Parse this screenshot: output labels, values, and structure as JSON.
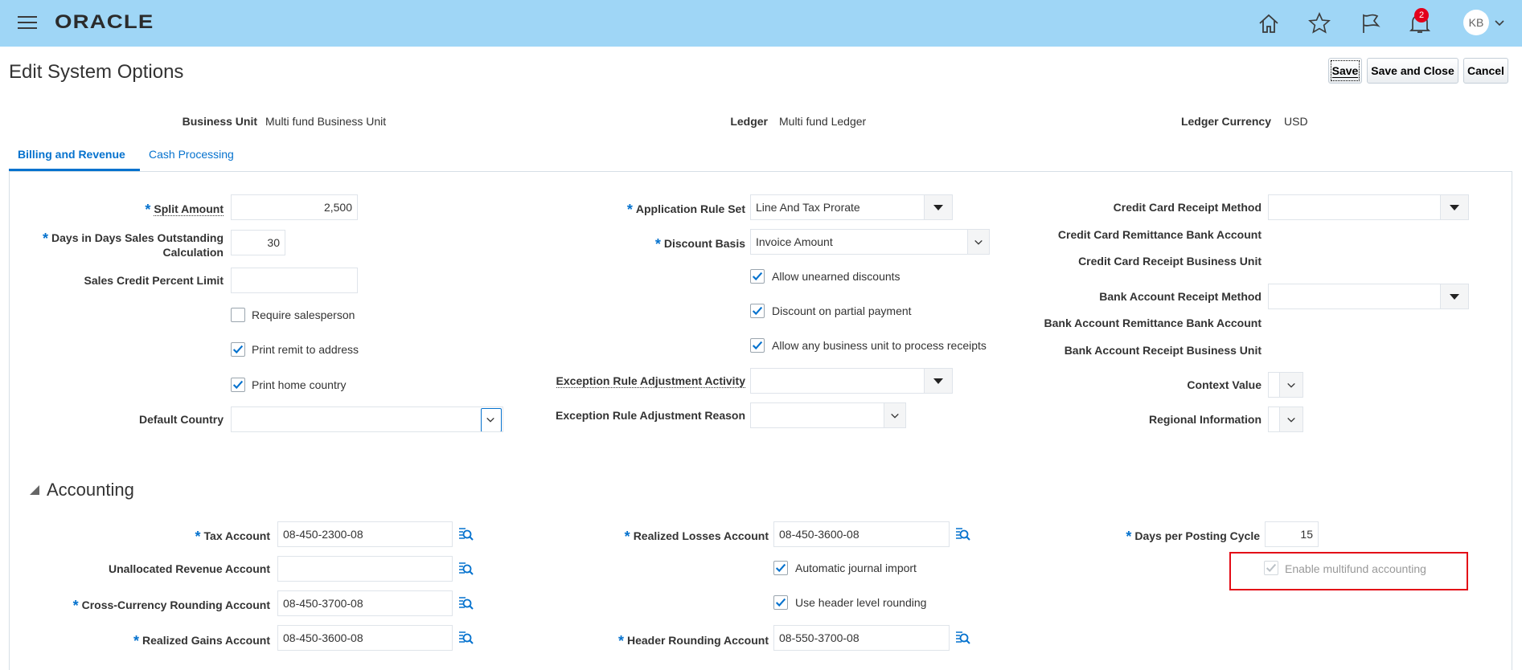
{
  "header": {
    "logo": "ORACLE",
    "notification_count": "2",
    "avatar_initials": "KB"
  },
  "page": {
    "title": "Edit System Options",
    "buttons": {
      "save": "Save",
      "save_close": "Save and Close",
      "cancel": "Cancel"
    }
  },
  "info": {
    "business_unit_label": "Business Unit",
    "business_unit_value": "Multi fund Business Unit",
    "ledger_label": "Ledger",
    "ledger_value": "Multi fund Ledger",
    "ledger_currency_label": "Ledger Currency",
    "ledger_currency_value": "USD"
  },
  "tabs": [
    "Billing and Revenue",
    "Cash Processing"
  ],
  "billing": {
    "split_amount_label": "Split Amount",
    "split_amount_value": "2,500",
    "dso_label_line1": "Days in Days Sales Outstanding",
    "dso_label_line2": "Calculation",
    "dso_value": "30",
    "sales_credit_label": "Sales Credit Percent Limit",
    "sales_credit_value": "",
    "require_salesperson": "Require salesperson",
    "print_remit": "Print remit to address",
    "print_home_country": "Print home country",
    "default_country_label": "Default Country",
    "default_country_value": "",
    "application_rule_set_label": "Application Rule Set",
    "application_rule_set_value": "Line And Tax Prorate",
    "discount_basis_label": "Discount Basis",
    "discount_basis_value": "Invoice Amount",
    "allow_unearned": "Allow unearned discounts",
    "discount_partial": "Discount on partial payment",
    "allow_any_bu": "Allow any business unit to process receipts",
    "exception_activity_label": "Exception Rule Adjustment Activity",
    "exception_activity_value": "",
    "exception_reason_label": "Exception Rule Adjustment Reason",
    "exception_reason_value": "",
    "cc_receipt_method_label": "Credit Card Receipt Method",
    "cc_remittance_bank_label": "Credit Card Remittance Bank Account",
    "cc_receipt_bu_label": "Credit Card Receipt Business Unit",
    "ba_receipt_method_label": "Bank Account Receipt Method",
    "ba_remittance_bank_label": "Bank Account Remittance Bank Account",
    "ba_receipt_bu_label": "Bank Account Receipt Business Unit",
    "context_value_label": "Context Value",
    "regional_info_label": "Regional Information"
  },
  "accounting": {
    "title": "Accounting",
    "tax_account_label": "Tax Account",
    "tax_account_value": "08-450-2300-08",
    "unallocated_label": "Unallocated Revenue Account",
    "unallocated_value": "",
    "cross_currency_label": "Cross-Currency Rounding Account",
    "cross_currency_value": "08-450-3700-08",
    "realized_gains_label": "Realized Gains Account",
    "realized_gains_value": "08-450-3600-08",
    "realized_losses_label": "Realized Losses Account",
    "realized_losses_value": "08-450-3600-08",
    "auto_journal_import": "Automatic journal import",
    "use_header_rounding": "Use header level rounding",
    "header_rounding_label": "Header Rounding Account",
    "header_rounding_value": "08-550-3700-08",
    "days_posting_label": "Days per Posting Cycle",
    "days_posting_value": "15",
    "enable_multifund": "Enable multifund accounting"
  },
  "colors": {
    "topbar": "#9fd6f6",
    "accent": "#0572ce",
    "highlight": "#e30b17"
  }
}
